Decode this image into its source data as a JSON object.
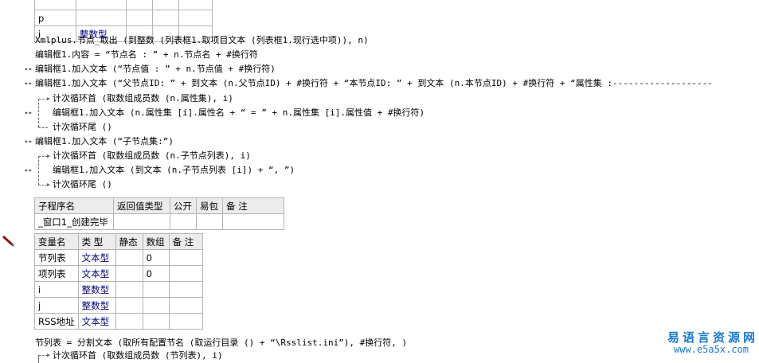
{
  "top_table": {
    "rows": [
      {
        "name": "p",
        "type": ""
      },
      {
        "name": "i",
        "type": "整数型"
      }
    ]
  },
  "code_lines": {
    "l1": "Xmlplus.节点_取出 (到整数 (列表框1.取项目文本 (列表框1.现行选中项)), n)",
    "l2": "编辑框1.内容 = “节点名 : ” + n.节点名 + #换行符",
    "l3": "编辑框1.加入文本 (“节点值 : ” + n.节点值 + #换行符)",
    "l4": "编辑框1.加入文本 (“父节点ID: ” + 到文本 (n.父节点ID) + #换行符 + “本节点ID: ” + 到文本 (n.本节点ID) + #换行符 + “属性集 :-------------------",
    "l5": "计次循环首 (取数组成员数 (n.属性集), i)",
    "l6": "编辑框1.加入文本 (n.属性集 [i].属性名 + “ = ” + n.属性集 [i].属性值 + #换行符)",
    "l7": "计次循环尾 ()",
    "l8": "编辑框1.加入文本 (“子节点集:”)",
    "l9": "计次循环首 (取数组成员数 (n.子节点列表), i)",
    "l10": "编辑框1.加入文本 (到文本 (n.子节点列表 [i]) + “, ”)",
    "l11": "计次循环尾 ()",
    "l12": "节列表 = 分割文本 (取所有配置节名 (取运行目录 () + “\\Rsslist.ini”), #换行符, )",
    "l13": "计次循环首 (取数组成员数 (节列表), i)"
  },
  "sub_table": {
    "headers": [
      "子程序名",
      "返回值类型",
      "公开",
      "易包",
      "备 注"
    ],
    "name": "_窗口1_创建完毕"
  },
  "var_table": {
    "headers": [
      "变量名",
      "类 型",
      "静态",
      "数组",
      "备 注"
    ],
    "rows": [
      {
        "name": "节列表",
        "type": "文本型",
        "array": "0"
      },
      {
        "name": "项列表",
        "type": "文本型",
        "array": "0"
      },
      {
        "name": "i",
        "type": "整数型",
        "array": ""
      },
      {
        "name": "j",
        "type": "整数型",
        "array": ""
      },
      {
        "name": "RSS地址",
        "type": "文本型",
        "array": ""
      }
    ]
  },
  "watermark": {
    "cn": "易语言资源网",
    "url": "www.e5a5x.com"
  },
  "colors": {
    "type_blue": "#000080",
    "string_teal": "#008080",
    "keyword_maroon": "#800000",
    "watermark_blue": "#1c7bd1"
  }
}
